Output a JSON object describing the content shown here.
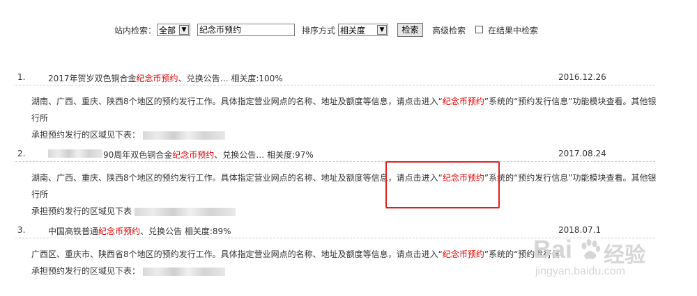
{
  "search": {
    "site_label": "站内检索：",
    "scope_value": "全部",
    "query_value": "纪念币预约",
    "sort_label": "排序方式",
    "sort_value": "相关度",
    "search_button": "检索",
    "advanced_link": "高级检索",
    "within_results_label": "在结果中检索"
  },
  "results": [
    {
      "num": "1.",
      "title_before": "2017年贺岁双色铜合金",
      "title_hl": "纪念币预约",
      "title_after": "、兑换公告…  相关度:100%",
      "date": "2016.12.26",
      "desc_line1_a": "湖南、广西、重庆、陕西8个地区的预约发行工作。具体指定营业网点的名称、地址及额度等信息，请点击进入“",
      "desc_hl": "纪念币预约",
      "desc_line1_b": "”系统的“预约发行信息”功能模块查看。其他银行所",
      "desc_line2": "承担预约发行的区域见下表："
    },
    {
      "num": "2.",
      "title_before": "90周年双色铜合金",
      "title_hl": "纪念币预约",
      "title_after": "、兑换公告…  相关度:97%",
      "date": "2017.08.24",
      "desc_line1_a": "湖南、广西、重庆、陕西8个地区的预约发行工作。具体指定营业网点的名称、地址及额度等信息，请点击进入“",
      "desc_hl": "纪念币预约",
      "desc_line1_b": "”系统的“预约发行信息”功能模块查看。其他银行所",
      "desc_line2": "承担预约发行的区域见下表"
    },
    {
      "num": "3.",
      "title_before": "中国高铁普通",
      "title_hl": "纪念币预约",
      "title_after": "、兑换公告  相关度:89%",
      "date": "2018.07.1",
      "desc_line1_a": "广西区、重庆市、陕西省8个地区的预约发行工作。具体指定营业网点的名称、地址及额度等信息，请点击进入“",
      "desc_hl": "纪念币预约",
      "desc_line1_b": "”系统的“预约发行信",
      "desc_line2": "承担预约发行的区域见下表："
    }
  ],
  "watermark": {
    "brand": "Bai",
    "brand_cn": "经验",
    "url": "jingyan.baidu.com"
  }
}
